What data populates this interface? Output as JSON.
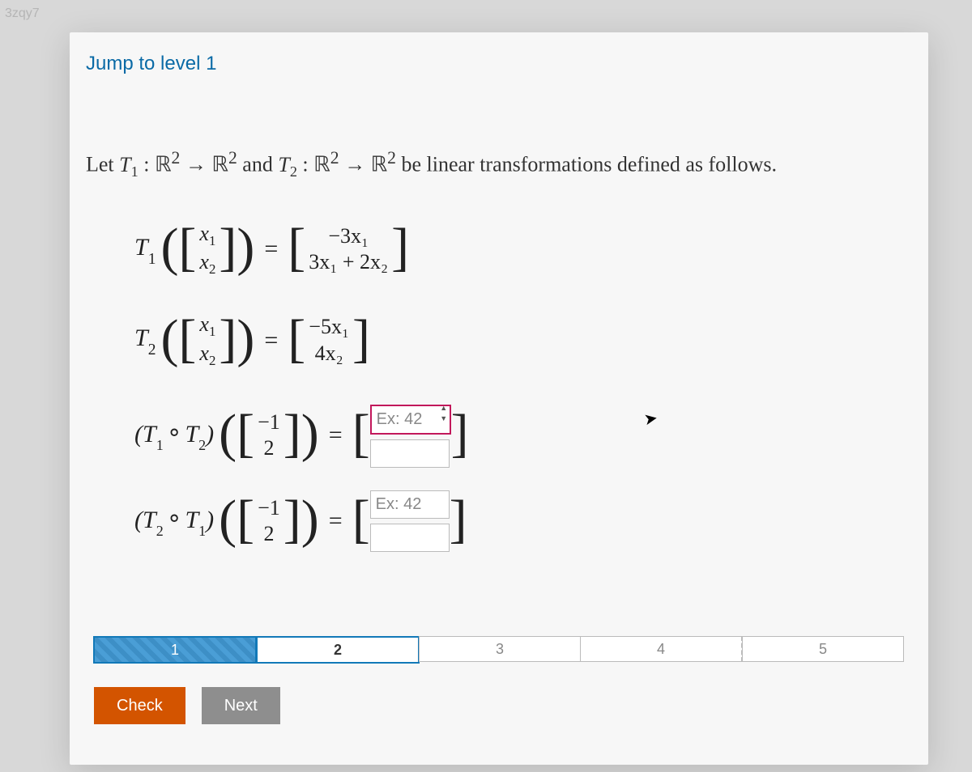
{
  "watermark": "3zqy7",
  "jump_link": "Jump to level 1",
  "prompt": {
    "pre": "Let ",
    "t1": "T",
    "t1_sub": "1",
    "sep1": " : ",
    "R": "ℝ",
    "sup2": "2",
    "arrow": " → ",
    "and": " and ",
    "t2": "T",
    "t2_sub": "2",
    "tail": " be linear transformations defined as follows."
  },
  "eq1": {
    "label": "T",
    "label_sub": "1",
    "in_top": "x",
    "in_top_sub": "1",
    "in_bot": "x",
    "in_bot_sub": "2",
    "out_top": "−3x₁",
    "out_bot": "3x₁ + 2x₂"
  },
  "eq2": {
    "label": "T",
    "label_sub": "2",
    "in_top": "x",
    "in_top_sub": "1",
    "in_bot": "x",
    "in_bot_sub": "2",
    "out_top": "−5x₁",
    "out_bot": "4x₂"
  },
  "ans1": {
    "comp_a": "T",
    "comp_a_sub": "1",
    "comp_b": "T",
    "comp_b_sub": "2",
    "vec_top": "−1",
    "vec_bot": "2",
    "placeholder_top": "Ex: 42",
    "value_top": "",
    "value_bot": ""
  },
  "ans2": {
    "comp_a": "T",
    "comp_a_sub": "2",
    "comp_b": "T",
    "comp_b_sub": "1",
    "vec_top": "−1",
    "vec_bot": "2",
    "placeholder_top": "Ex: 42",
    "value_top": "",
    "value_bot": ""
  },
  "steps": [
    "1",
    "2",
    "3",
    "4",
    "5"
  ],
  "buttons": {
    "check": "Check",
    "next": "Next"
  }
}
